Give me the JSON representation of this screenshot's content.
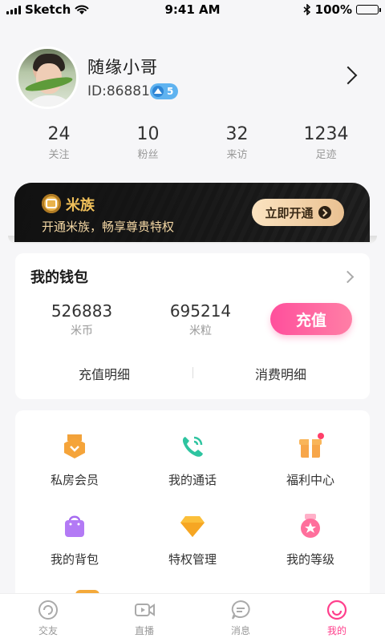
{
  "status_bar": {
    "carrier": "Sketch",
    "time": "9:41 AM",
    "battery": "100%",
    "battery_level": 1.0
  },
  "profile": {
    "name": "随缘小哥",
    "id": "ID:86881",
    "level": "5"
  },
  "stats": [
    {
      "value": "24",
      "label": "关注"
    },
    {
      "value": "10",
      "label": "粉丝"
    },
    {
      "value": "32",
      "label": "来访"
    },
    {
      "value": "1234",
      "label": "足迹"
    }
  ],
  "vip": {
    "title": "米族",
    "subtitle": "开通米族，畅享尊贵特权",
    "button": "立即开通"
  },
  "wallet": {
    "title": "我的钱包",
    "coins": {
      "value": "526883",
      "label": "米币"
    },
    "grains": {
      "value": "695214",
      "label": "米粒"
    },
    "recharge": "充值",
    "recharge_detail": "充值明细",
    "spend_detail": "消费明细"
  },
  "features": [
    {
      "label": "私房会员",
      "icon": "medal-icon"
    },
    {
      "label": "我的通话",
      "icon": "phone-icon"
    },
    {
      "label": "福利中心",
      "icon": "gift-icon"
    },
    {
      "label": "我的背包",
      "icon": "bag-icon"
    },
    {
      "label": "特权管理",
      "icon": "diamond-icon"
    },
    {
      "label": "我的等级",
      "icon": "level-icon"
    }
  ],
  "tabs": [
    {
      "label": "交友",
      "icon": "friends-icon"
    },
    {
      "label": "直播",
      "icon": "live-icon"
    },
    {
      "label": "消息",
      "icon": "message-icon"
    },
    {
      "label": "我的",
      "icon": "me-icon",
      "active": true
    }
  ],
  "colors": {
    "accent": "#ff3f8c",
    "vip_gold": "#f0c05a",
    "badge_blue": "#5fb3f0"
  }
}
